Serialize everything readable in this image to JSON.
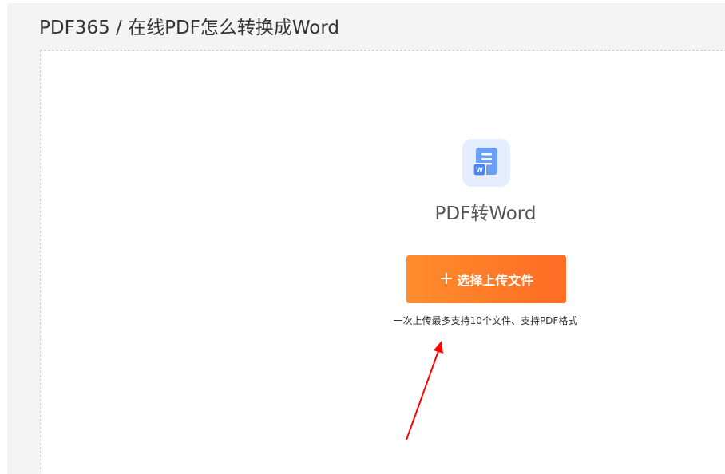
{
  "header": {
    "breadcrumb": "PDF365 / 在线PDF怎么转换成Word"
  },
  "converter": {
    "icon": "word-document-icon",
    "title": "PDF转Word",
    "upload_button_label": "选择上传文件",
    "hint": "一次上传最多支持10个文件、支持PDF格式"
  },
  "colors": {
    "accent_orange": "#ff7a28",
    "icon_blue": "#4a86f7",
    "annotation_red": "#ff0000"
  }
}
